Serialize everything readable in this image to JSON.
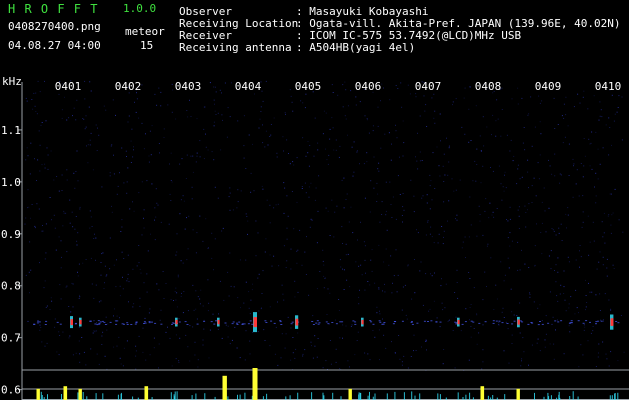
{
  "app": {
    "name": "H R O F F T",
    "version": "1.0.0",
    "file": "0408270400.png",
    "datetime": "04.08.27 04:00",
    "count_label": "meteor",
    "count_value": "15"
  },
  "info": [
    {
      "label": "Observer",
      "value": ": Masayuki Kobayashi"
    },
    {
      "label": "Receiving Location",
      "value": ": Ogata-vill. Akita-Pref. JAPAN (139.96E, 40.02N)"
    },
    {
      "label": "Receiver",
      "value": ": ICOM IC-575 53.7492(@LCD)MHz USB"
    },
    {
      "label": "Receiving antenna",
      "value": ": A504HB(yagi 4el)"
    }
  ],
  "colors": {
    "text_green": "#3fe03f",
    "text_white": "#ffffff",
    "background": "#000000",
    "axis": "#9aa0a6",
    "noise": "#2a35b0",
    "meteor_core": "#ff3a3a",
    "meteor_halo": "#33e6ff",
    "spike": "#ffff33"
  },
  "chart_data": {
    "type": "heatmap",
    "ylabel": "kHz",
    "ylim": [
      0.58,
      1.2
    ],
    "y_ticks": [
      {
        "value": 1.1,
        "label": "1.1"
      },
      {
        "value": 1.0,
        "label": "1.0"
      },
      {
        "value": 0.9,
        "label": "0.9"
      },
      {
        "value": 0.8,
        "label": "0.8"
      },
      {
        "value": 0.7,
        "label": "0.7"
      },
      {
        "value": 0.6,
        "label": "0.6"
      }
    ],
    "x_ticks": [
      "0401",
      "0402",
      "0403",
      "0404",
      "0405",
      "0406",
      "0407",
      "0408",
      "0409",
      "0410"
    ],
    "xlim": [
      0,
      10
    ],
    "echo_band_khz": 0.73,
    "echoes": [
      {
        "t": 0.05,
        "strength": 0.5
      },
      {
        "t": 0.2,
        "strength": 0.3
      },
      {
        "t": 1.8,
        "strength": 0.3
      },
      {
        "t": 2.5,
        "strength": 0.3
      },
      {
        "t": 3.1,
        "strength": 1.0
      },
      {
        "t": 3.8,
        "strength": 0.6
      },
      {
        "t": 4.9,
        "strength": 0.3
      },
      {
        "t": 6.5,
        "strength": 0.3
      },
      {
        "t": 7.5,
        "strength": 0.4
      },
      {
        "t": 9.05,
        "strength": 0.7
      },
      {
        "t": 9.9,
        "strength": 0.5
      }
    ],
    "spikes": [
      {
        "t": -0.5,
        "level": 0.2
      },
      {
        "t": -0.05,
        "level": 0.3
      },
      {
        "t": 0.2,
        "level": 0.2
      },
      {
        "t": 1.3,
        "level": 0.3
      },
      {
        "t": 2.6,
        "level": 0.7
      },
      {
        "t": 3.1,
        "level": 1.0
      },
      {
        "t": 4.7,
        "level": 0.2
      },
      {
        "t": 6.9,
        "level": 0.3
      },
      {
        "t": 7.5,
        "level": 0.2
      },
      {
        "t": 9.9,
        "level": 0.6
      }
    ]
  }
}
